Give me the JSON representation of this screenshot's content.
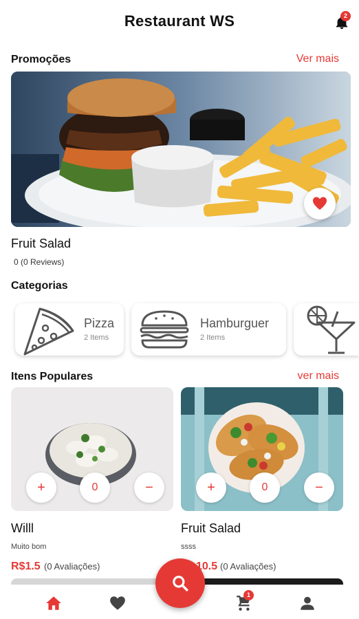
{
  "header": {
    "title": "Restaurant WS",
    "notification_count": "2"
  },
  "promotions": {
    "title": "Promoções",
    "see_more": "Ver mais",
    "item": {
      "name": "Fruit Salad",
      "reviews": "0 (0 Reviews)",
      "favorite": true
    }
  },
  "categories": {
    "title": "Categorias",
    "items": [
      {
        "name": "Pizza",
        "count": "2 Items",
        "icon": "pizza-slice-icon"
      },
      {
        "name": "Hamburguer",
        "count": "2 Items",
        "icon": "burger-icon"
      },
      {
        "name": "",
        "count": "",
        "icon": "cocktail-icon"
      }
    ]
  },
  "popular": {
    "title": "Itens Populares",
    "see_more": "ver mais",
    "items": [
      {
        "name": "Willl",
        "description": "Muito bom",
        "price": "R$1.5",
        "reviews": "(0 Avaliações)",
        "quantity": "0"
      },
      {
        "name": "Fruit Salad",
        "description": "ssss",
        "price": "R$10.5",
        "price_visible": "10.5",
        "reviews": "(0 Avaliações)",
        "quantity": "0"
      }
    ]
  },
  "bottom_nav": {
    "items": [
      "home-icon",
      "heart-icon",
      "search-icon",
      "cart-icon",
      "person-icon"
    ],
    "cart_count": "1"
  },
  "colors": {
    "accent": "#e53935",
    "text": "#111111",
    "muted": "#888888"
  }
}
